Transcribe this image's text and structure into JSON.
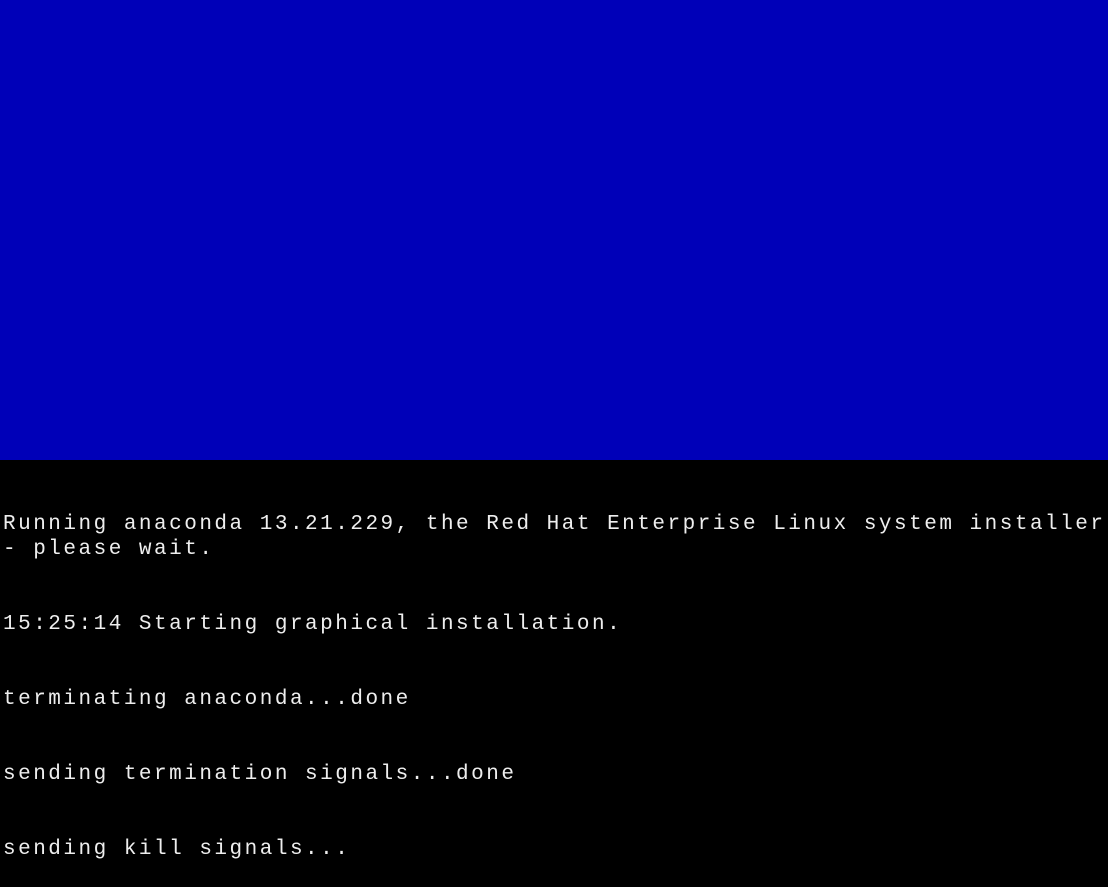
{
  "console": {
    "lines": [
      "Running anaconda 13.21.229, the Red Hat Enterprise Linux system installer - please wait.",
      "15:25:14 Starting graphical installation.",
      "terminating anaconda...done",
      "sending termination signals...done",
      "sending kill signals..."
    ]
  },
  "colors": {
    "blue_panel": "#0000b8",
    "console_bg": "#000000",
    "console_fg": "#eeeeee"
  }
}
